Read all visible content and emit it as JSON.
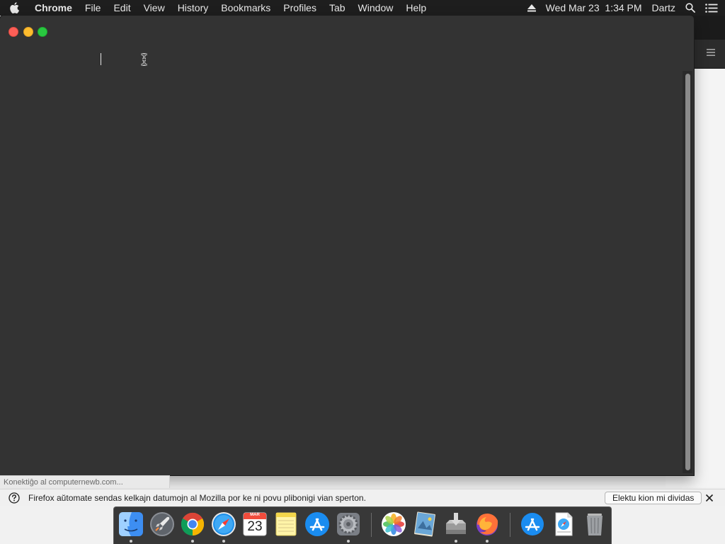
{
  "menubar": {
    "app_name": "Chrome",
    "menus": [
      "File",
      "Edit",
      "View",
      "History",
      "Bookmarks",
      "Profiles",
      "Tab",
      "Window",
      "Help"
    ],
    "clock": "Wed Mar 23  1:34 PM",
    "user": "Dartz"
  },
  "status": {
    "text": "Konektiĝo al computernewb.com..."
  },
  "notification": {
    "message": "Firefox aŭtomate sendas kelkajn datumojn al Mozilla por ke ni povu plibonigi vian sperton.",
    "button_label": "Elektu kion mi dividas"
  },
  "dock": {
    "calendar": {
      "month": "MAR",
      "day": "23"
    },
    "items": [
      "finder",
      "launchpad",
      "chrome",
      "safari",
      "calendar",
      "notes",
      "app-store",
      "system-preferences",
      "photos",
      "preview",
      "installer",
      "firefox",
      "app-store-download",
      "safari-download",
      "trash"
    ]
  }
}
